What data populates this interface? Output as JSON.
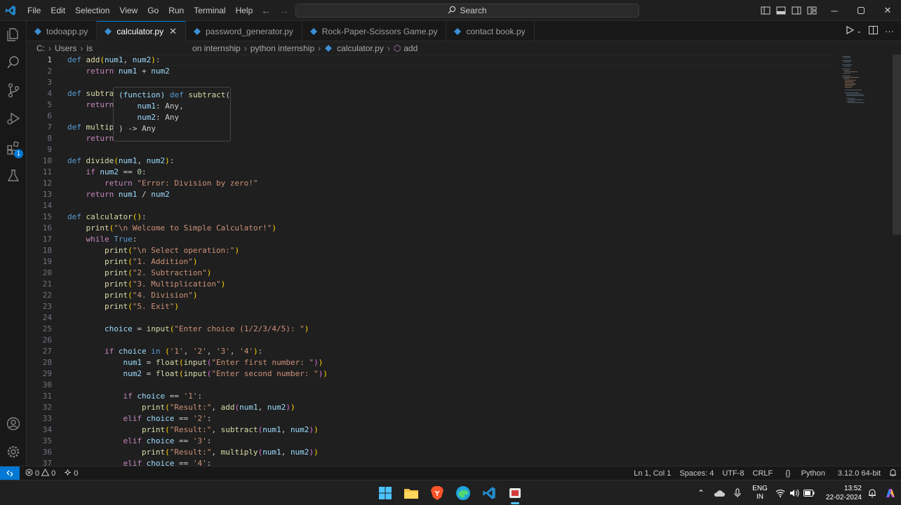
{
  "menu": [
    "File",
    "Edit",
    "Selection",
    "View",
    "Go",
    "Run",
    "Terminal",
    "Help"
  ],
  "search": {
    "label": "Search"
  },
  "tabs": [
    {
      "label": "todoapp.py",
      "active": false
    },
    {
      "label": "calculator.py",
      "active": true
    },
    {
      "label": "password_generator.py",
      "active": false
    },
    {
      "label": "Rock-Paper-Scissors Game.py",
      "active": false
    },
    {
      "label": "contact book.py",
      "active": false
    }
  ],
  "breadcrumbs": {
    "drive": "C:",
    "users": "Users",
    "partial": "is",
    "internship_folder": "on internship",
    "folder": "python internship",
    "file": "calculator.py",
    "symbol": "add"
  },
  "hover": {
    "line1": "(function) def subtract(",
    "line2": "    num1: Any,",
    "line3": "    num2: Any",
    "line4": ") -> Any"
  },
  "code_lines": [
    "def add(num1, num2):",
    "    return num1 + num2",
    "",
    "def subtract(num1, num2):",
    "    return num1 - num2",
    "",
    "def multiply(num1, num2):",
    "    return num1 * num2",
    "",
    "def divide(num1, num2):",
    "    if num2 == 0:",
    "        return \"Error: Division by zero!\"",
    "    return num1 / num2",
    "",
    "def calculator():",
    "    print(\"\\n Welcome to Simple Calculator!\")",
    "    while True:",
    "        print(\"\\n Select operation:\")",
    "        print(\"1. Addition\")",
    "        print(\"2. Subtraction\")",
    "        print(\"3. Multiplication\")",
    "        print(\"4. Division\")",
    "        print(\"5. Exit\")",
    "",
    "        choice = input(\"Enter choice (1/2/3/4/5): \")",
    "",
    "        if choice in ('1', '2', '3', '4'):",
    "            num1 = float(input(\"Enter first number: \"))",
    "            num2 = float(input(\"Enter second number: \"))",
    "",
    "            if choice == '1':",
    "                print(\"Result:\", add(num1, num2))",
    "            elif choice == '2':",
    "                print(\"Result:\", subtract(num1, num2))",
    "            elif choice == '3':",
    "                print(\"Result:\", multiply(num1, num2))",
    "            elif choice == '4':"
  ],
  "status": {
    "errors": "0",
    "warnings": "0",
    "ports": "0",
    "position": "Ln 1, Col 1",
    "spaces": "Spaces: 4",
    "encoding": "UTF-8",
    "eol": "CRLF",
    "language": "Python",
    "interpreter": "3.12.0 64-bit"
  },
  "tray": {
    "lang1": "ENG",
    "lang2": "IN",
    "time": "13:52",
    "date": "22-02-2024"
  },
  "colors": {
    "accent": "#0078d4",
    "keyword": "#569cd6",
    "control": "#c586c0",
    "function": "#dcdcaa",
    "variable": "#9cdcfe",
    "string": "#ce9178",
    "number": "#b5cea8"
  }
}
